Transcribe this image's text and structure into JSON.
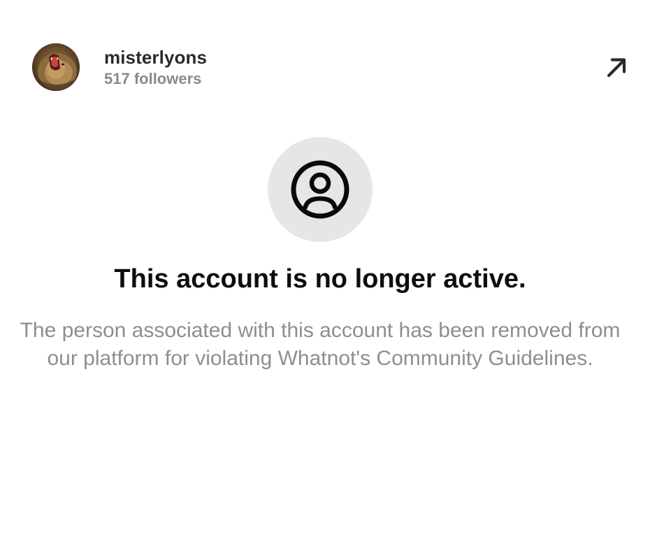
{
  "header": {
    "username": "misterlyons",
    "followers": "517 followers",
    "avatar_icon": "lion-avatar",
    "open_icon": "arrow-up-right-icon"
  },
  "main": {
    "placeholder_icon": "user-circle-icon",
    "headline": "This account is no longer active.",
    "description": "The person associated with this account has been removed from our platform for violating Whatnot's Community Guidelines."
  },
  "colors": {
    "background": "#ffffff",
    "headline": "#0d0d0d",
    "muted_text": "#8e8e8e",
    "placeholder_bg": "#e6e6e6"
  }
}
